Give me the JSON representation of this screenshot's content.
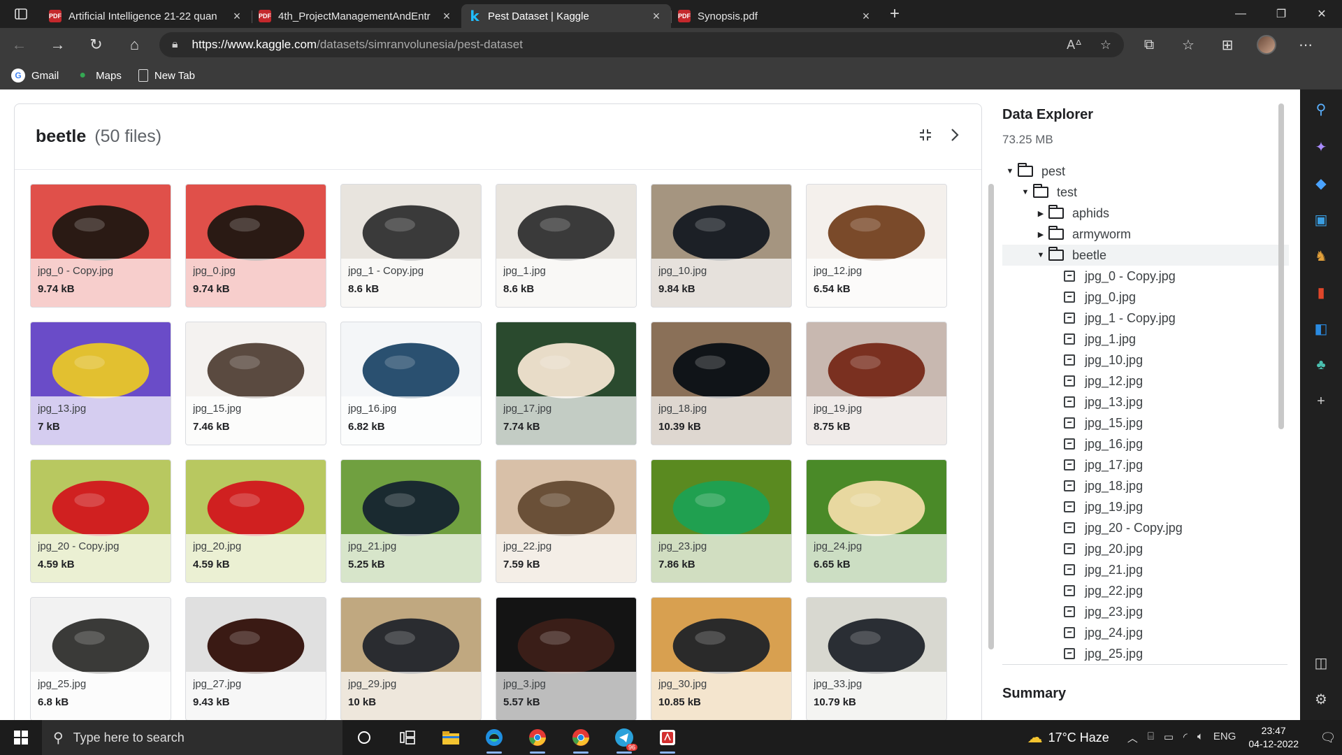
{
  "browser": {
    "tabs": [
      {
        "title": "Artificial Intelligence 21-22 quan",
        "favicon": "pdf",
        "active": false
      },
      {
        "title": "4th_ProjectManagementAndEntr",
        "favicon": "pdf",
        "active": false
      },
      {
        "title": "Pest Dataset | Kaggle",
        "favicon": "kaggle",
        "active": true
      },
      {
        "title": "Synopsis.pdf",
        "favicon": "pdf",
        "active": false
      }
    ],
    "url_host": "https://www.kaggle.com",
    "url_path": "/datasets/simranvolunesia/pest-dataset",
    "bookmarks": [
      {
        "label": "Gmail",
        "icon": "google-icon"
      },
      {
        "label": "Maps",
        "icon": "maps-pin-icon"
      },
      {
        "label": "New Tab",
        "icon": "page-icon"
      }
    ]
  },
  "panel": {
    "title": "beetle",
    "count": "(50 files)"
  },
  "files": [
    {
      "name": "jpg_0 - Copy.jpg",
      "size": "9.74 kB",
      "colors": [
        "#2a1a14",
        "#e0504a"
      ]
    },
    {
      "name": "jpg_0.jpg",
      "size": "9.74 kB",
      "colors": [
        "#2a1a14",
        "#e0504a"
      ]
    },
    {
      "name": "jpg_1 - Copy.jpg",
      "size": "8.6 kB",
      "colors": [
        "#3a3a3a",
        "#e8e4de"
      ]
    },
    {
      "name": "jpg_1.jpg",
      "size": "8.6 kB",
      "colors": [
        "#3a3a3a",
        "#e8e4de"
      ]
    },
    {
      "name": "jpg_10.jpg",
      "size": "9.84 kB",
      "colors": [
        "#1c2026",
        "#a59580"
      ]
    },
    {
      "name": "jpg_12.jpg",
      "size": "6.54 kB",
      "colors": [
        "#7a4a2a",
        "#f4f0ec"
      ]
    },
    {
      "name": "jpg_13.jpg",
      "size": "7 kB",
      "colors": [
        "#e2c030",
        "#6a4cc8"
      ]
    },
    {
      "name": "jpg_15.jpg",
      "size": "7.46 kB",
      "colors": [
        "#5a4a40",
        "#f4f2f0"
      ]
    },
    {
      "name": "jpg_16.jpg",
      "size": "6.82 kB",
      "colors": [
        "#2a5070",
        "#f4f6f8"
      ]
    },
    {
      "name": "jpg_17.jpg",
      "size": "7.74 kB",
      "colors": [
        "#e8dcc8",
        "#2a4a2e"
      ]
    },
    {
      "name": "jpg_18.jpg",
      "size": "10.39 kB",
      "colors": [
        "#101418",
        "#8a7058"
      ]
    },
    {
      "name": "jpg_19.jpg",
      "size": "8.75 kB",
      "colors": [
        "#7a3020",
        "#c8b8b0"
      ]
    },
    {
      "name": "jpg_20 - Copy.jpg",
      "size": "4.59 kB",
      "colors": [
        "#d02020",
        "#b8c860"
      ]
    },
    {
      "name": "jpg_20.jpg",
      "size": "4.59 kB",
      "colors": [
        "#d02020",
        "#b8c860"
      ]
    },
    {
      "name": "jpg_21.jpg",
      "size": "5.25 kB",
      "colors": [
        "#1a2a30",
        "#70a040"
      ]
    },
    {
      "name": "jpg_22.jpg",
      "size": "7.59 kB",
      "colors": [
        "#6a5038",
        "#d8c0a8"
      ]
    },
    {
      "name": "jpg_23.jpg",
      "size": "7.86 kB",
      "colors": [
        "#20a050",
        "#5a8a20"
      ]
    },
    {
      "name": "jpg_24.jpg",
      "size": "6.65 kB",
      "colors": [
        "#e8d8a0",
        "#4a8a28"
      ]
    },
    {
      "name": "jpg_25.jpg",
      "size": "6.8 kB",
      "colors": [
        "#3a3a38",
        "#f2f2f2"
      ]
    },
    {
      "name": "jpg_27.jpg",
      "size": "9.43 kB",
      "colors": [
        "#3a1a14",
        "#e0e0e0"
      ]
    },
    {
      "name": "jpg_29.jpg",
      "size": "10 kB",
      "colors": [
        "#2a2c30",
        "#c0a880"
      ]
    },
    {
      "name": "jpg_3.jpg",
      "size": "5.57 kB",
      "colors": [
        "#3a1e18",
        "#141414"
      ]
    },
    {
      "name": "jpg_30.jpg",
      "size": "10.85 kB",
      "colors": [
        "#2a2a2a",
        "#d8a050"
      ]
    },
    {
      "name": "jpg_33.jpg",
      "size": "10.79 kB",
      "colors": [
        "#2a2e34",
        "#d8d8d0"
      ]
    }
  ],
  "explorer": {
    "title": "Data Explorer",
    "size": "73.25 MB",
    "tree": [
      {
        "label": "pest",
        "type": "folder",
        "depth": 0,
        "caret": "down"
      },
      {
        "label": "test",
        "type": "folder",
        "depth": 1,
        "caret": "down"
      },
      {
        "label": "aphids",
        "type": "folder",
        "depth": 2,
        "caret": "right"
      },
      {
        "label": "armyworm",
        "type": "folder",
        "depth": 2,
        "caret": "right"
      },
      {
        "label": "beetle",
        "type": "folder",
        "depth": 2,
        "caret": "down",
        "selected": true
      },
      {
        "label": "jpg_0 - Copy.jpg",
        "type": "file",
        "depth": 3
      },
      {
        "label": "jpg_0.jpg",
        "type": "file",
        "depth": 3
      },
      {
        "label": "jpg_1 - Copy.jpg",
        "type": "file",
        "depth": 3
      },
      {
        "label": "jpg_1.jpg",
        "type": "file",
        "depth": 3
      },
      {
        "label": "jpg_10.jpg",
        "type": "file",
        "depth": 3
      },
      {
        "label": "jpg_12.jpg",
        "type": "file",
        "depth": 3
      },
      {
        "label": "jpg_13.jpg",
        "type": "file",
        "depth": 3
      },
      {
        "label": "jpg_15.jpg",
        "type": "file",
        "depth": 3
      },
      {
        "label": "jpg_16.jpg",
        "type": "file",
        "depth": 3
      },
      {
        "label": "jpg_17.jpg",
        "type": "file",
        "depth": 3
      },
      {
        "label": "jpg_18.jpg",
        "type": "file",
        "depth": 3
      },
      {
        "label": "jpg_19.jpg",
        "type": "file",
        "depth": 3
      },
      {
        "label": "jpg_20 - Copy.jpg",
        "type": "file",
        "depth": 3
      },
      {
        "label": "jpg_20.jpg",
        "type": "file",
        "depth": 3
      },
      {
        "label": "jpg_21.jpg",
        "type": "file",
        "depth": 3
      },
      {
        "label": "jpg_22.jpg",
        "type": "file",
        "depth": 3
      },
      {
        "label": "jpg_23.jpg",
        "type": "file",
        "depth": 3
      },
      {
        "label": "jpg_24.jpg",
        "type": "file",
        "depth": 3
      },
      {
        "label": "jpg_25.jpg",
        "type": "file",
        "depth": 3
      }
    ],
    "summary_title": "Summary"
  },
  "taskbar": {
    "search_placeholder": "Type here to search",
    "weather": "17°C  Haze",
    "language": "ENG",
    "time": "23:47",
    "date": "04-12-2022",
    "telegram_badge": "96"
  }
}
